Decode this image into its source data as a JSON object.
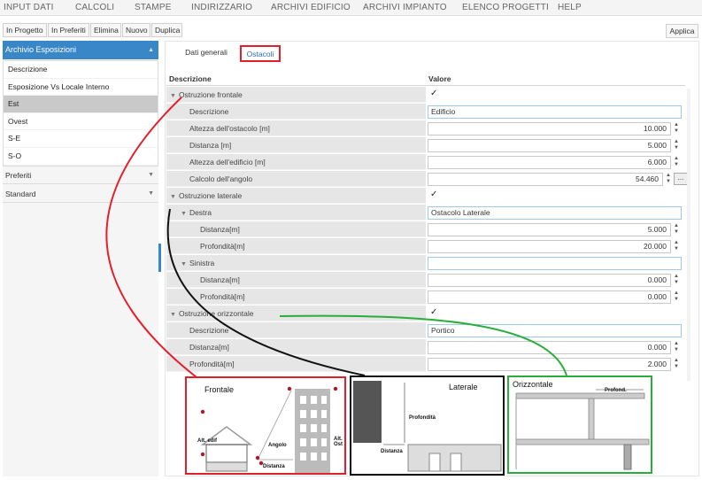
{
  "menu": [
    "INPUT DATI",
    "CALCOLI",
    "STAMPE",
    "INDIRIZZARIO",
    "ARCHIVI EDIFICIO",
    "ARCHIVI IMPIANTO",
    "ELENCO PROGETTI",
    "HELP"
  ],
  "toolbar": {
    "buttons": [
      "In Progetto",
      "In Preferiti",
      "Elimina",
      "Nuovo",
      "Duplica"
    ],
    "apply": "Applica"
  },
  "left": {
    "header": "Archivio Esposizioni",
    "items": [
      "Descrizione",
      "Esposizione Vs Locale Interno",
      "Est",
      "Ovest",
      "S-E",
      "S-O"
    ],
    "selected_index": 2,
    "sections": [
      "Preferiti",
      "Standard"
    ]
  },
  "tabs": [
    "Dati generali",
    "Ostacoli"
  ],
  "active_tab": "Ostacoli",
  "grid": {
    "col_desc": "Descrizione",
    "col_val": "Valore",
    "rows": [
      {
        "label": "Ostruzione frontale",
        "kind": "check",
        "checked": true,
        "expander": true
      },
      {
        "label": "Descrizione",
        "kind": "text",
        "value": "Edificio"
      },
      {
        "label": "Altezza dell'ostacolo [m]",
        "kind": "num",
        "value": "10.000"
      },
      {
        "label": "Distanza [m]",
        "kind": "num",
        "value": "5.000"
      },
      {
        "label": "Altezza dell'edificio [m]",
        "kind": "num",
        "value": "6.000"
      },
      {
        "label": "Calcolo dell'angolo",
        "kind": "numbtn",
        "value": "54.460",
        "button": "..."
      },
      {
        "label": "Ostruzione laterale",
        "kind": "check",
        "checked": true,
        "expander": true
      },
      {
        "label": "Destra",
        "kind": "text",
        "value": "Ostacolo Laterale",
        "expander": true
      },
      {
        "label": "Distanza[m]",
        "kind": "num",
        "value": "5.000"
      },
      {
        "label": "Profondità[m]",
        "kind": "num",
        "value": "20.000"
      },
      {
        "label": "Sinistra",
        "kind": "text",
        "value": "",
        "expander": true
      },
      {
        "label": "Distanza[m]",
        "kind": "num",
        "value": "0.000"
      },
      {
        "label": "Profondità[m]",
        "kind": "num",
        "value": "0.000"
      },
      {
        "label": "Ostruzione orizzontale",
        "kind": "check",
        "checked": true,
        "expander": true
      },
      {
        "label": "Descrizione",
        "kind": "text",
        "value": "Portico"
      },
      {
        "label": "Distanza[m]",
        "kind": "num",
        "value": "0.000"
      },
      {
        "label": "Profondità[m]",
        "kind": "num",
        "value": "2.000"
      }
    ]
  },
  "diagrams": {
    "frontale": {
      "title": "Frontale",
      "labels": [
        "Alt. edif",
        "Angolo",
        "Alt. Ost",
        "Distanza"
      ]
    },
    "laterale": {
      "title": "Laterale",
      "labels": [
        "Profondità",
        "Distanza"
      ]
    },
    "orizzontale": {
      "title": "Orizzontale",
      "labels": [
        "Profond."
      ]
    }
  },
  "colors": {
    "accent": "#3a87c8",
    "frontale": "#e41e2a",
    "laterale": "#111111",
    "orizzontale": "#2aae3a",
    "selected_row": "#c9c9c9"
  }
}
